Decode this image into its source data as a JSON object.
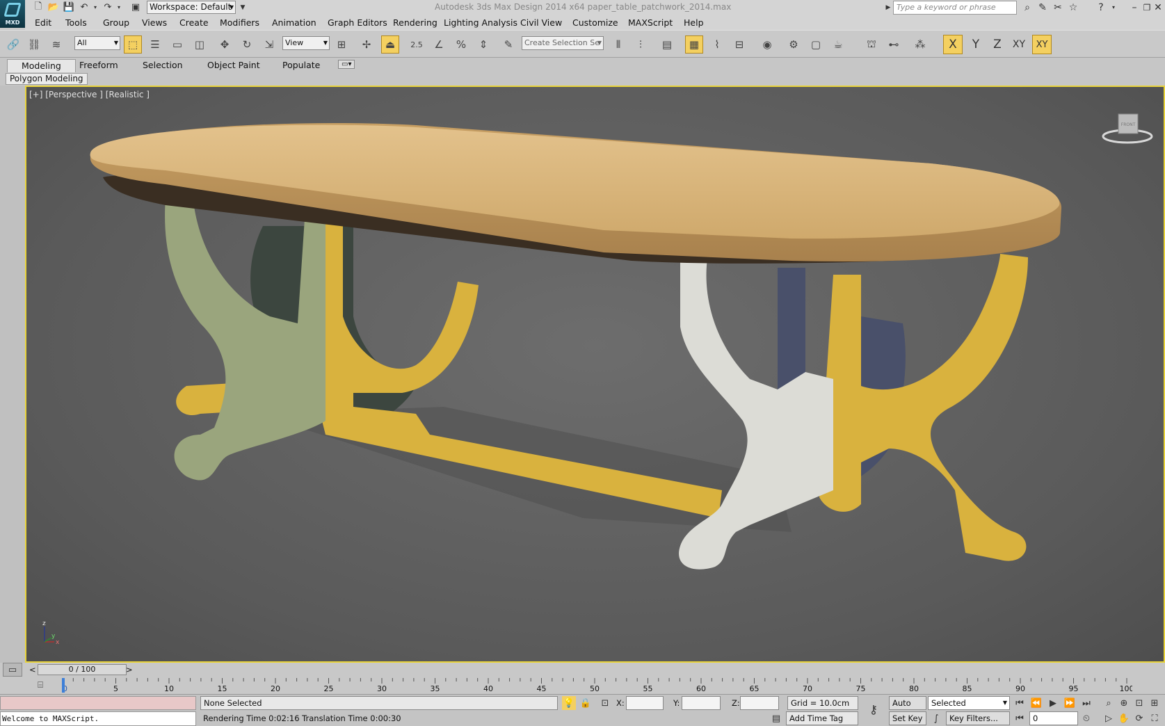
{
  "titlebar": {
    "app_logo": "MXD",
    "workspace": "Workspace: Default",
    "title": "Autodesk 3ds Max Design 2014 x64      paper_table_patchwork_2014.max",
    "search_placeholder": "Type a keyword or phrase"
  },
  "menu": [
    "Edit",
    "Tools",
    "Group",
    "Views",
    "Create",
    "Modifiers",
    "Animation",
    "Graph Editors",
    "Rendering",
    "Lighting Analysis",
    "Civil View",
    "Customize",
    "MAXScript",
    "Help"
  ],
  "toolbar": {
    "filter_select": "All",
    "ref_coord_select": "View",
    "snap_percent": "2.5",
    "selection_set": "Create Selection Se",
    "axis": [
      "X",
      "Y",
      "Z",
      "XY",
      "XY"
    ]
  },
  "ribbon": {
    "tabs": [
      "Modeling",
      "Freeform",
      "Selection",
      "Object Paint",
      "Populate"
    ],
    "active_tab": "Modeling",
    "panel_label": "Polygon Modeling"
  },
  "viewport": {
    "label": "[+] [Perspective ] [Realistic ]",
    "viewcube_label": "FRONT",
    "axis_z": "z",
    "axis_y": "y",
    "axis_x": "x",
    "colors": {
      "tabletop": "#d9b57c",
      "leg_green": "#9aa57d",
      "leg_yellow": "#d9b23e",
      "leg_white": "#dcdcd6",
      "leg_dark": "#3c463f",
      "leg_blue": "#49506a"
    }
  },
  "timeslider": {
    "frame_readout": "0 / 100",
    "prev": "<",
    "next": ">"
  },
  "trackbar": {
    "ticks": [
      "0",
      "5",
      "10",
      "15",
      "20",
      "25",
      "30",
      "35",
      "40",
      "45",
      "50",
      "55",
      "60",
      "65",
      "70",
      "75",
      "80",
      "85",
      "90",
      "95",
      "100"
    ]
  },
  "status": {
    "maxscript_output": "Welcome to MAXScript.",
    "selection": "None Selected",
    "render_info": "Rendering Time  0:02:16    Translation Time  0:00:30",
    "x_label": "X:",
    "y_label": "Y:",
    "z_label": "Z:",
    "grid": "Grid = 10.0cm",
    "add_time_tag": "Add Time Tag",
    "auto_key": "Auto Key",
    "set_key": "Set Key",
    "key_mode_select": "Selected",
    "key_filters": "Key Filters...",
    "current_frame": "0"
  }
}
